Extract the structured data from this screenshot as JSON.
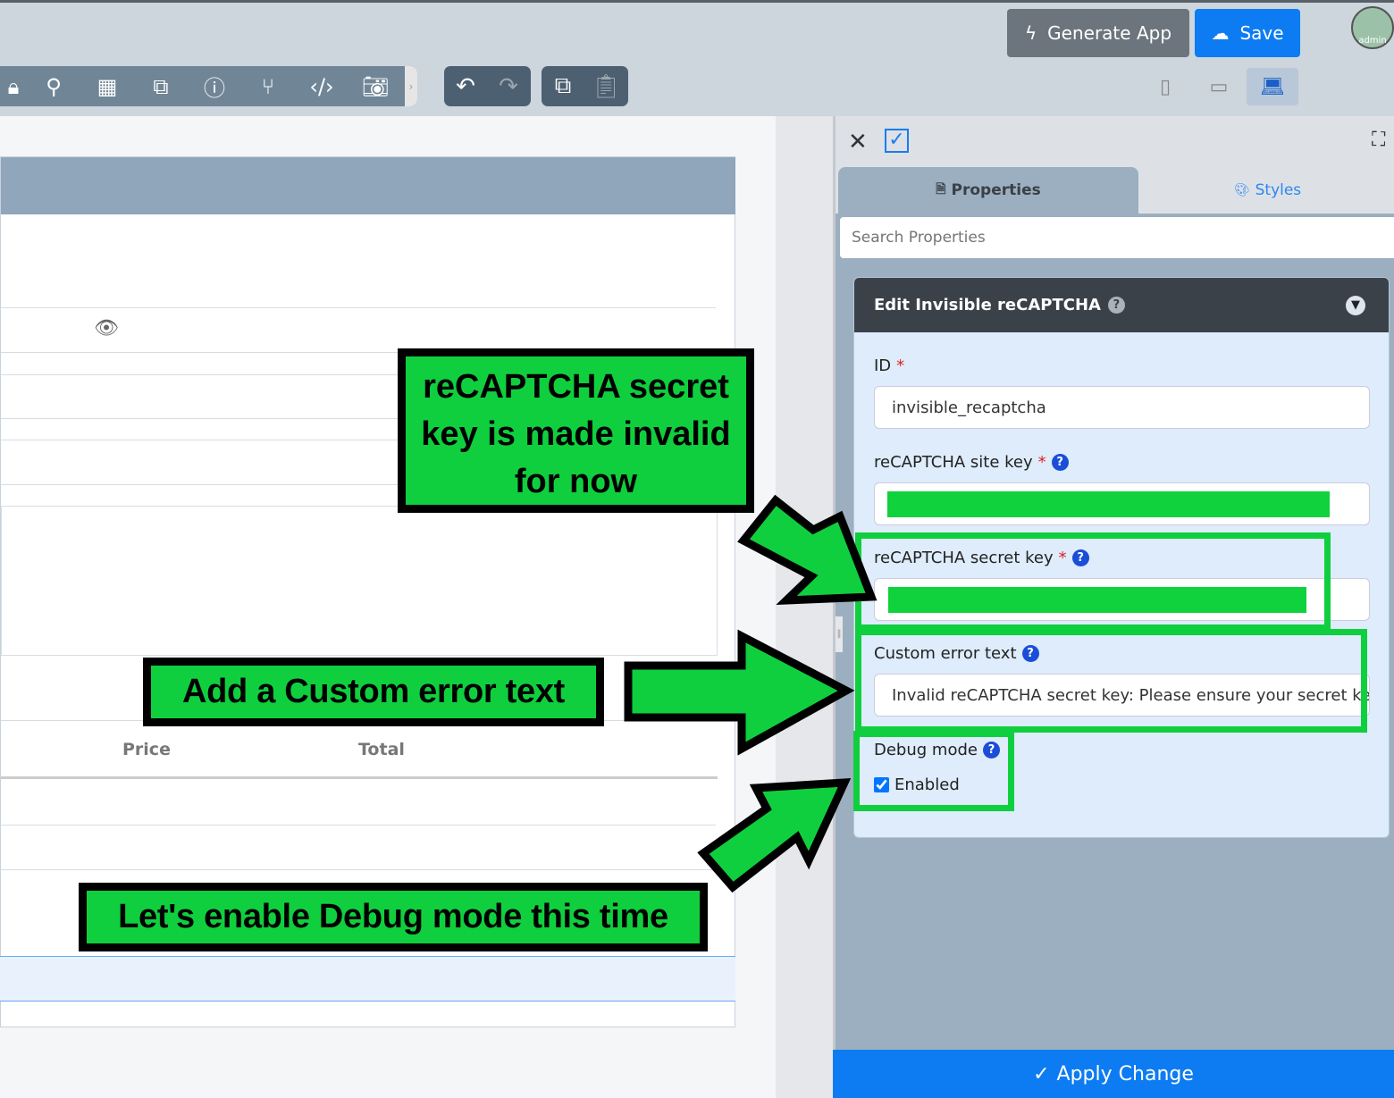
{
  "toolbar": {
    "icons": [
      "lock-icon",
      "binoculars-icon",
      "grid-icon",
      "translate-icon",
      "help-icon",
      "branch-icon",
      "code-icon",
      "camera-icon"
    ],
    "generate_label": "Generate App",
    "save_label": "Save",
    "avatar_label": "admin"
  },
  "canvas": {
    "columns": {
      "price": "Price",
      "total": "Total"
    }
  },
  "panel": {
    "tabs": {
      "properties": "Properties",
      "styles": "Styles"
    },
    "search_placeholder": "Search Properties",
    "card_title": "Edit Invisible reCAPTCHA",
    "fields": {
      "id_label": "ID",
      "id_value": "invisible_recaptcha",
      "site_key_label": "reCAPTCHA site key",
      "secret_key_label": "reCAPTCHA secret key",
      "custom_error_label": "Custom error text",
      "custom_error_value": "Invalid reCAPTCHA secret key: Please ensure your secret key",
      "debug_label": "Debug mode",
      "debug_option": "Enabled",
      "debug_checked": true,
      "required_mark": "*",
      "help_mark": "?"
    },
    "apply_label": "Apply Change"
  },
  "annotations": {
    "secret": "reCAPTCHA secret key is made invalid for now",
    "custom": "Add a Custom error text",
    "debug": "Let's enable Debug mode this time",
    "color": "#10cf3e"
  }
}
